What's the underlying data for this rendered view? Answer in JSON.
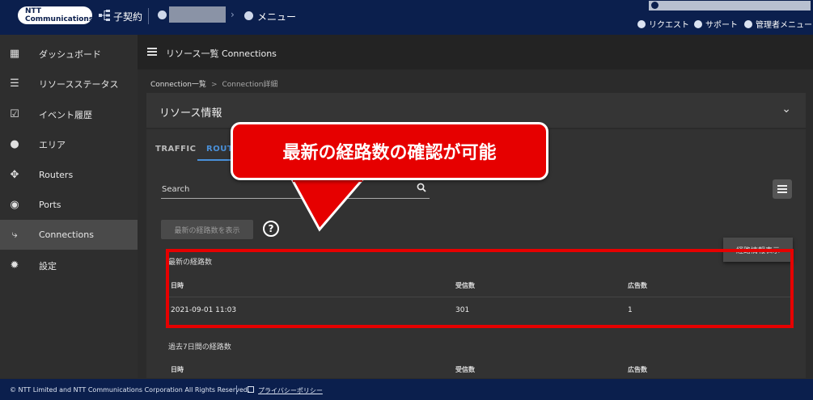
{
  "header": {
    "logo_text": "NTT Communications",
    "contract_label": "子契約",
    "menu_label": "メニュー",
    "links": {
      "request": "リクエスト",
      "support": "サポート",
      "admin": "管理者メニュー"
    }
  },
  "sidebar": {
    "items": [
      {
        "label": "ダッシュボード",
        "icon": "grid-icon"
      },
      {
        "label": "リソースステータス",
        "icon": "status-list-icon"
      },
      {
        "label": "イベント履歴",
        "icon": "calendar-check-icon"
      },
      {
        "label": "エリア",
        "icon": "globe-icon"
      },
      {
        "label": "Routers",
        "icon": "router-icon"
      },
      {
        "label": "Ports",
        "icon": "toggle-icon"
      },
      {
        "label": "Connections",
        "icon": "connection-icon",
        "active": true
      },
      {
        "label": "設定",
        "icon": "gear-icon"
      }
    ]
  },
  "main": {
    "title": "リソース一覧 Connections",
    "breadcrumb": {
      "root": "Connection一覧",
      "separator": ">",
      "current": "Connection詳細"
    },
    "resource_card_title": "リソース情報",
    "tabs": [
      {
        "label": "TRAFFIC"
      },
      {
        "label": "ROUTE"
      }
    ],
    "search": {
      "label": "Search"
    },
    "show_latest_button": "最新の経路数を表示",
    "route_info_button": "経路情報表示",
    "latest": {
      "title": "最新の経路数",
      "columns": {
        "datetime": "日時",
        "received": "受信数",
        "advertised": "広告数"
      },
      "rows": [
        {
          "datetime": "2021-09-01 11:03",
          "received": "301",
          "advertised": "1"
        }
      ]
    },
    "past7": {
      "title": "過去7日間の経路数",
      "columns": {
        "datetime": "日時",
        "received": "受信数",
        "advertised": "広告数"
      }
    }
  },
  "callout": {
    "text": "最新の経路数の確認が可能",
    "color": "#e60000"
  },
  "footer": {
    "copyright": "© NTT Limited and NTT Communications Corporation All Rights Reserved.",
    "privacy": "プライバシーポリシー"
  }
}
